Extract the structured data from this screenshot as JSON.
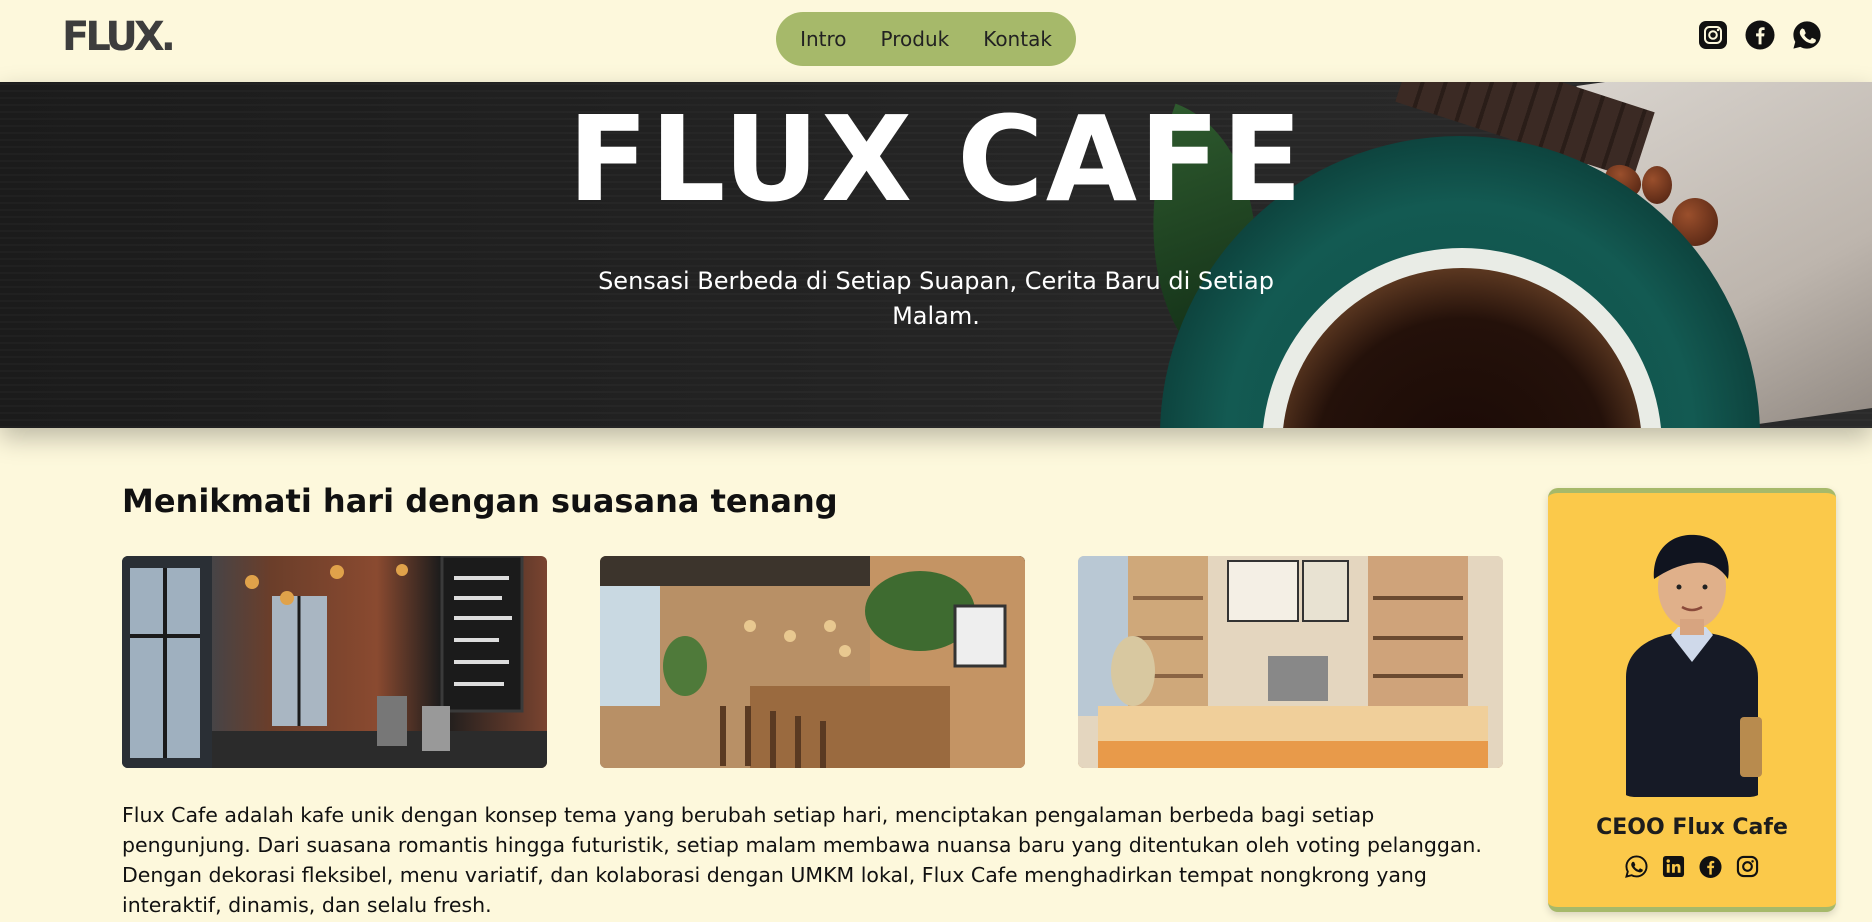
{
  "header": {
    "logo": "FLUX.",
    "nav": [
      "Intro",
      "Produk",
      "Kontak"
    ],
    "social_icons": [
      "instagram-icon",
      "facebook-icon",
      "whatsapp-icon"
    ]
  },
  "hero": {
    "title": "FLUX CAFE",
    "subtitle": "Sensasi Berbeda di Setiap Suapan, Cerita Baru di Setiap Malam."
  },
  "intro": {
    "heading": "Menikmati hari dengan suasana tenang",
    "photos": [
      "cafe-interior-brick-photo",
      "cafe-bar-counter-photo",
      "cafe-coffee-shop-photo"
    ],
    "description": "Flux Cafe adalah kafe unik dengan konsep tema yang berubah setiap hari, menciptakan pengalaman berbeda bagi setiap pengunjung. Dari suasana romantis hingga futuristik, setiap malam membawa nuansa baru yang ditentukan oleh voting pelanggan. Dengan dekorasi fleksibel, menu variatif, dan kolaborasi dengan UMKM lokal, Flux Cafe menghadirkan tempat nongkrong yang interaktif, dinamis, dan selalu fresh."
  },
  "profile_card": {
    "name": "CEOO Flux Cafe",
    "social_icons": [
      "whatsapp-icon",
      "linkedin-icon",
      "facebook-icon",
      "instagram-icon"
    ]
  },
  "colors": {
    "background": "#fdf8dc",
    "nav_pill": "#a6b96a",
    "card": "#fbc94a"
  }
}
